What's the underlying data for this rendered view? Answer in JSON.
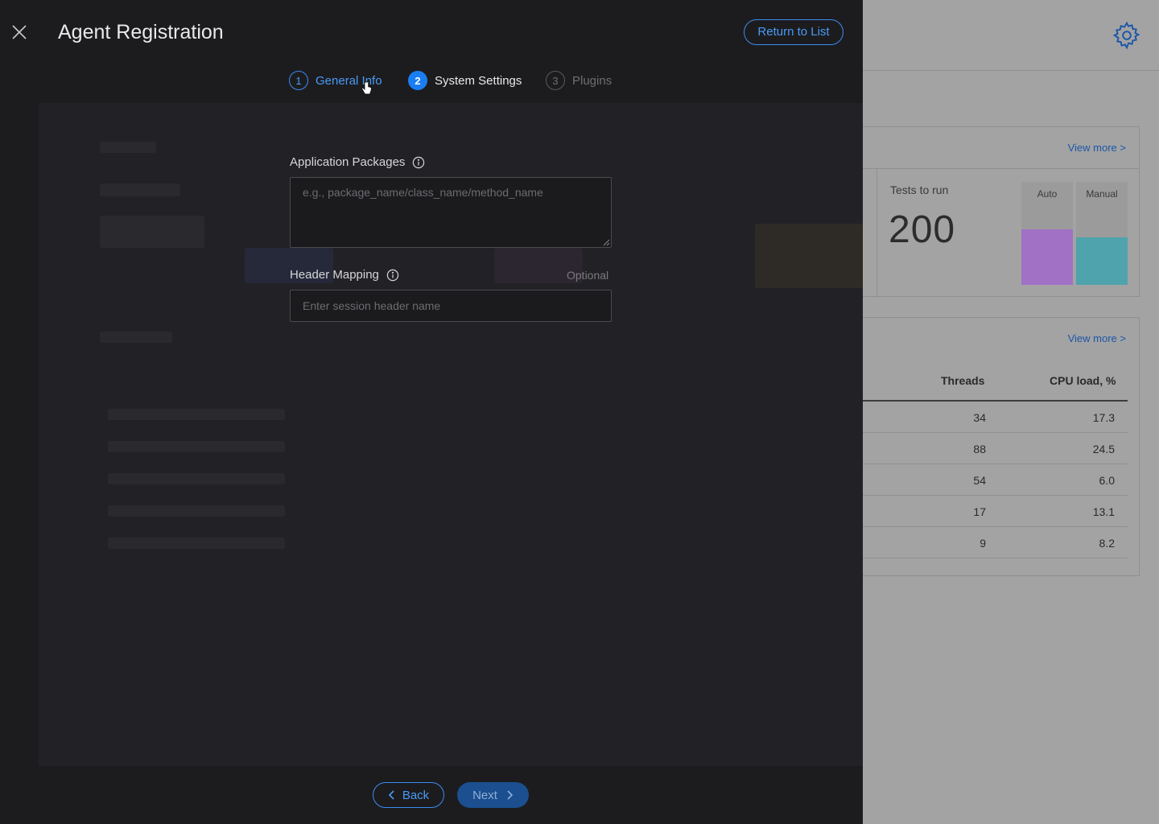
{
  "modal": {
    "title": "Agent Registration",
    "return_label": "Return to List",
    "steps": [
      {
        "number": "1",
        "label": "General Info",
        "state": "done"
      },
      {
        "number": "2",
        "label": "System Settings",
        "state": "active"
      },
      {
        "number": "3",
        "label": "Plugins",
        "state": "pending"
      }
    ],
    "fields": {
      "app_packages": {
        "label": "Application Packages",
        "placeholder": "e.g., package_name/class_name/method_name",
        "value": ""
      },
      "header_mapping": {
        "label": "Header Mapping",
        "optional": "Optional",
        "placeholder": "Enter session header name",
        "value": ""
      }
    },
    "back_label": "Back",
    "next_label": "Next"
  },
  "dashboard": {
    "view_more_1": "View more >",
    "view_more_2": "View more >",
    "tests_label": "Tests to run",
    "tests_value": "200",
    "bars": [
      {
        "label": "Auto",
        "fraction": 0.54,
        "color": "#a071c4"
      },
      {
        "label": "Manual",
        "fraction": 0.46,
        "color": "#4fa3ad"
      }
    ],
    "table": {
      "columns": [
        "Threads",
        "CPU load, %"
      ],
      "rows": [
        [
          "34",
          "17.3"
        ],
        [
          "88",
          "24.5"
        ],
        [
          "54",
          "6.0"
        ],
        [
          "17",
          "13.1"
        ],
        [
          "9",
          "8.2"
        ]
      ]
    }
  },
  "colors": {
    "accent": "#1a7ef2",
    "modal_bg": "#1c1c1f"
  }
}
